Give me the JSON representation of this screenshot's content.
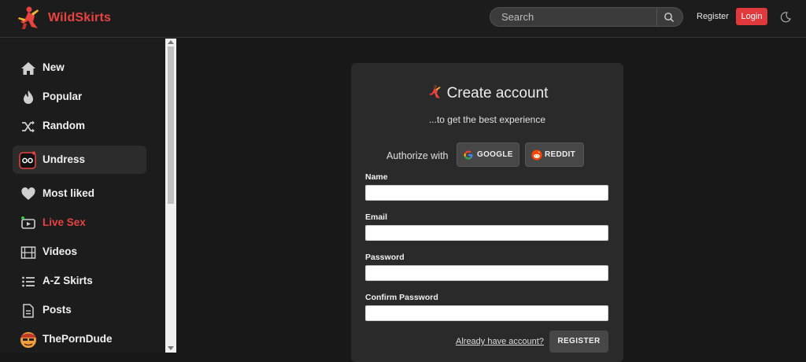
{
  "header": {
    "brand": "WildSkirts",
    "search_placeholder": "Search",
    "register_label": "Register",
    "login_label": "Login",
    "login_color": "#e0393c"
  },
  "sidebar": {
    "items": [
      {
        "label": "New",
        "icon": "home-icon"
      },
      {
        "label": "Popular",
        "icon": "fire-icon"
      },
      {
        "label": "Random",
        "icon": "shuffle-icon"
      },
      {
        "label": "Undress",
        "icon": "undress-icon",
        "active": true
      },
      {
        "label": "Most liked",
        "icon": "heart-icon"
      },
      {
        "label": "Live Sex",
        "icon": "live-camera-icon",
        "color": "#e8433f"
      },
      {
        "label": "Videos",
        "icon": "film-icon"
      },
      {
        "label": "A-Z Skirts",
        "icon": "list-icon"
      },
      {
        "label": "Posts",
        "icon": "document-icon"
      },
      {
        "label": "ThePornDude",
        "icon": "dude-avatar-icon"
      }
    ]
  },
  "form": {
    "title": "Create account",
    "subtitle": "...to get the best experience",
    "authorize_label": "Authorize with",
    "google_label": "GOOGLE",
    "reddit_label": "REDDIT",
    "name_label": "Name",
    "name_value": "",
    "email_label": "Email",
    "email_value": "",
    "password_label": "Password",
    "password_value": "",
    "confirm_label": "Confirm Password",
    "confirm_value": "",
    "already_label": "Already have account?",
    "register_button": "REGISTER"
  }
}
